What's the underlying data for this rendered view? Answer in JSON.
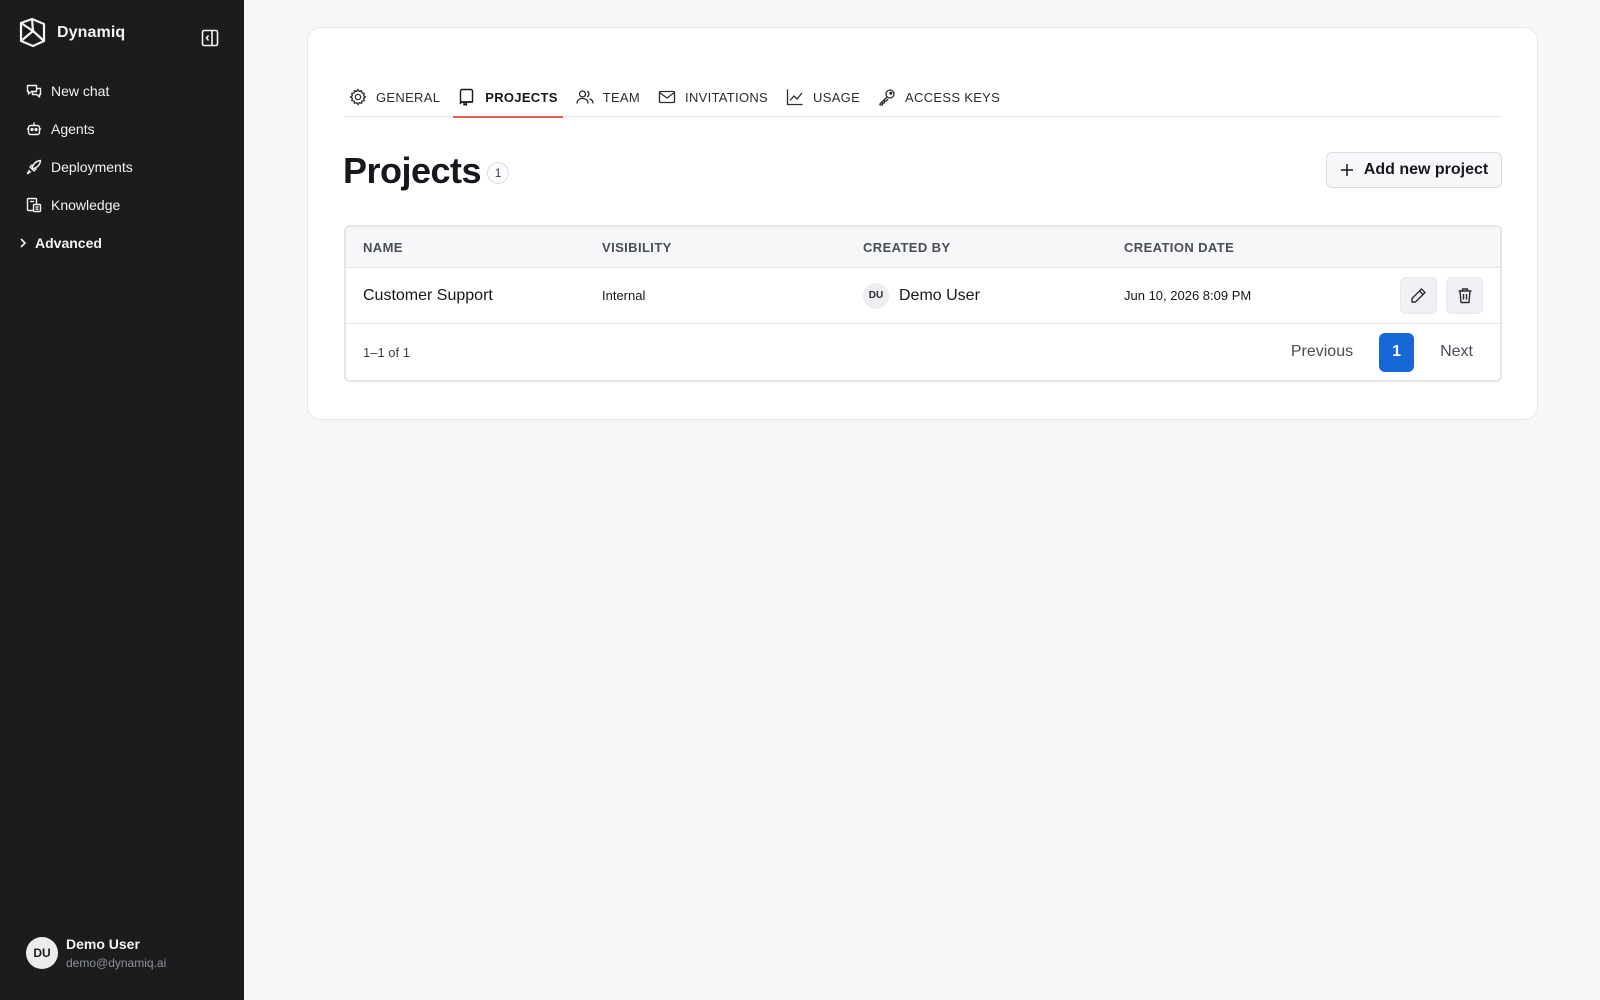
{
  "sidebar": {
    "brand": "Dynamiq",
    "brand_icon": "dynamiq-logo-icon",
    "items": [
      {
        "label": "New chat",
        "icon": "chat-bubbles-icon"
      },
      {
        "label": "Agents",
        "icon": "robot-icon"
      },
      {
        "label": "Deployments",
        "icon": "rocket-icon"
      },
      {
        "label": "Knowledge",
        "icon": "knowledge-docs-icon"
      },
      {
        "label": "Advanced",
        "icon": "chevron-right-icon"
      }
    ],
    "user": {
      "initials": "DU",
      "name": "Demo User",
      "email": "demo@dynamiq.ai"
    }
  },
  "tabs": [
    {
      "label": "GENERAL",
      "icon": "gear-icon",
      "active": false
    },
    {
      "label": "PROJECTS",
      "icon": "folder-icon",
      "active": true
    },
    {
      "label": "TEAM",
      "icon": "users-icon",
      "active": false
    },
    {
      "label": "INVITATIONS",
      "icon": "envelope-icon",
      "active": false
    },
    {
      "label": "USAGE",
      "icon": "line-chart-icon",
      "active": false
    },
    {
      "label": "ACCESS KEYS",
      "icon": "key-icon",
      "active": false
    }
  ],
  "page": {
    "title": "Projects",
    "count": "1",
    "add_button": "Add new project"
  },
  "table": {
    "columns": [
      "NAME",
      "VISIBILITY",
      "CREATED BY",
      "CREATION DATE"
    ],
    "rows": [
      {
        "name": "Customer Support",
        "visibility": "Internal",
        "creator_initials": "DU",
        "creator_name": "Demo User",
        "created": "Jun 10, 2026 8:09 PM"
      }
    ],
    "range_text": "1–1 of 1",
    "pagination": {
      "previous": "Previous",
      "current": "1",
      "next": "Next"
    }
  },
  "colors": {
    "sidebar_bg": "#1b1c1e",
    "active_tab_underline": "#e8604c",
    "primary": "#1568d6"
  }
}
